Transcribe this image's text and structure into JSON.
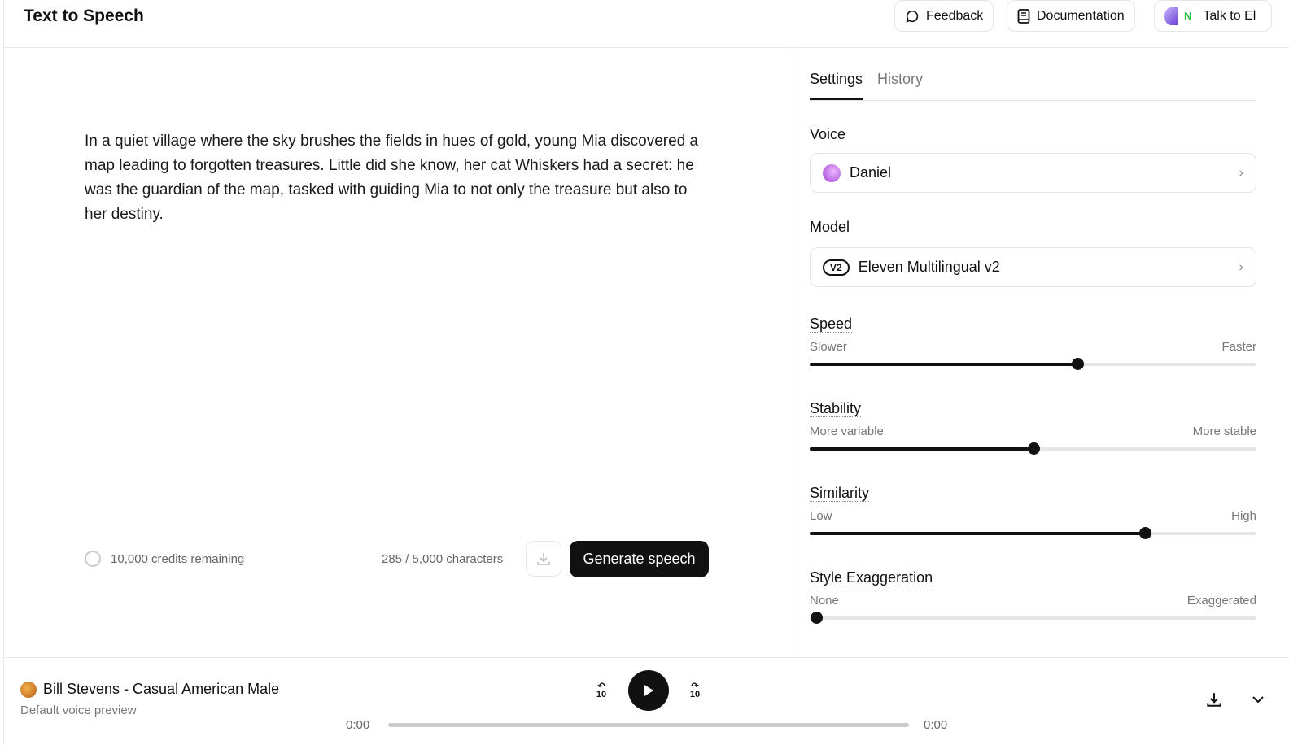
{
  "header": {
    "title": "Text to Speech",
    "feedback": "Feedback",
    "documentation": "Documentation",
    "talk": "Talk to El"
  },
  "editor": {
    "text": "In a quiet village where the sky brushes the fields in hues of gold, young Mia discovered a map leading to forgotten treasures. Little did she know, her cat Whiskers had a secret: he was the guardian of the map, tasked with guiding Mia to not only the treasure but also to her destiny.",
    "credits": "10,000 credits remaining",
    "chars": "285 / 5,000 characters",
    "generate": "Generate speech"
  },
  "settings": {
    "tabs": [
      "Settings",
      "History"
    ],
    "voice_label": "Voice",
    "voice": "Daniel",
    "model_label": "Model",
    "model_badge": "V2",
    "model": "Eleven Multilingual v2",
    "sliders": [
      {
        "label": "Speed",
        "min": "Slower",
        "max": "Faster",
        "value": 0.6
      },
      {
        "label": "Stability",
        "min": "More variable",
        "max": "More stable",
        "value": 0.5
      },
      {
        "label": "Similarity",
        "min": "Low",
        "max": "High",
        "value": 0.75
      },
      {
        "label": "Style Exaggeration",
        "min": "None",
        "max": "Exaggerated",
        "value": 0.0
      }
    ]
  },
  "player": {
    "name": "Bill Stevens - Casual American Male",
    "sub": "Default voice preview",
    "skip": "10",
    "current": "0:00",
    "total": "0:00",
    "progress": 0
  }
}
